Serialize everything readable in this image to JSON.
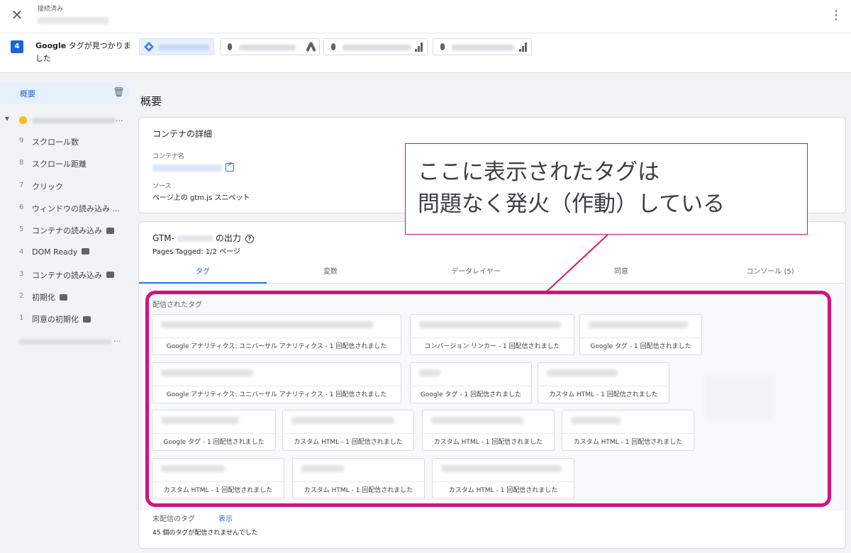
{
  "header": {
    "close_icon": "close-icon",
    "status_label": "接続済み",
    "menu_icon": "more-vert-icon"
  },
  "tagbar": {
    "count": "4",
    "found_text_bold": "Google",
    "found_text_rest": " タグが見つかりました",
    "containers": [
      {
        "kind": "gtm",
        "icon": "gtm-icon",
        "active": true
      },
      {
        "kind": "ads",
        "icon": "google-ads-icon",
        "active": false
      },
      {
        "kind": "analytics",
        "icon": "analytics-icon",
        "active": false
      },
      {
        "kind": "analytics",
        "icon": "analytics-icon",
        "active": false
      }
    ]
  },
  "sidebar": {
    "overview_label": "概要",
    "ellipsis": "...",
    "events": [
      {
        "num": "9",
        "label": "スクロール数",
        "msg": false
      },
      {
        "num": "8",
        "label": "スクロール距離",
        "msg": false
      },
      {
        "num": "7",
        "label": "クリック",
        "msg": false
      },
      {
        "num": "6",
        "label": "ウィンドウの読み込み ...",
        "msg": false
      },
      {
        "num": "5",
        "label": "コンテナの読み込み",
        "msg": true
      },
      {
        "num": "4",
        "label": "DOM Ready",
        "msg": true
      },
      {
        "num": "3",
        "label": "コンテナの読み込み",
        "msg": true
      },
      {
        "num": "2",
        "label": "初期化",
        "msg": true
      },
      {
        "num": "1",
        "label": "同意の初期化",
        "msg": true
      }
    ]
  },
  "main": {
    "title": "概要",
    "details": {
      "title": "コンテナの詳細",
      "name_label": "コンテナ名",
      "source_label": "ソース",
      "source_value": "ページ上の gtm.js スニペット"
    },
    "output": {
      "title_prefix": "GTM-",
      "title_suffix": "の出力",
      "pages_tagged": "Pages Tagged: 1/2 ページ",
      "tabs": [
        "タグ",
        "変数",
        "データレイヤー",
        "同意",
        "コンソール (5)"
      ],
      "active_tab": "タグ",
      "fired_label": "配信されたタグ",
      "fired_tags": [
        "Google アナリティクス: ユニバーサル アナリティクス - 1 回配信されました",
        "コンバージョン リンカー - 1 回配信されました",
        "Google タグ - 1 回配信されました",
        "Google アナリティクス: ユニバーサル アナリティクス - 1 回配信されました",
        "Google タグ - 1 回配信されました",
        "カスタム HTML - 1 回配信されました",
        "Google タグ - 1 回配信されました",
        "カスタム HTML - 1 回配信されました",
        "カスタム HTML - 1 回配信されました",
        "カスタム HTML - 1 回配信されました",
        "カスタム HTML - 1 回配信されました",
        "カスタム HTML - 1 回配信されました",
        "カスタム HTML - 1 回配信されました"
      ],
      "not_fired_label": "未配信のタグ",
      "show_link": "表示",
      "not_fired_count": "45 個のタグが配信されませんでした"
    }
  },
  "annotation": {
    "line1": "ここに表示されたタグは",
    "line2": "問題なく発火（作動）している",
    "color": "#d4127f"
  }
}
